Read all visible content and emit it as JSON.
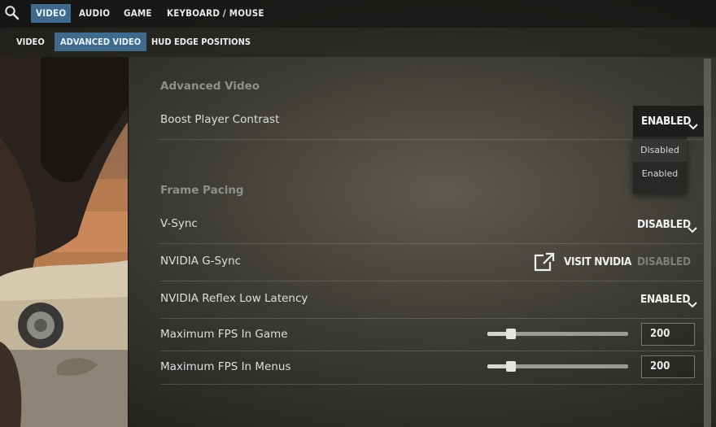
{
  "top_nav": {
    "search_icon": "search-icon",
    "tabs": [
      {
        "label": "VIDEO",
        "active": true
      },
      {
        "label": "AUDIO",
        "active": false
      },
      {
        "label": "GAME",
        "active": false
      },
      {
        "label": "KEYBOARD / MOUSE",
        "active": false
      }
    ]
  },
  "sub_nav": {
    "tabs": [
      {
        "label": "VIDEO",
        "active": false
      },
      {
        "label": "ADVANCED VIDEO",
        "active": true
      },
      {
        "label": "HUD EDGE POSITIONS",
        "active": false
      }
    ]
  },
  "advanced_video": {
    "title": "Advanced Video",
    "boost_player_contrast": {
      "label": "Boost Player Contrast",
      "value": "ENABLED",
      "options": [
        "Disabled",
        "Enabled"
      ],
      "open": true
    }
  },
  "frame_pacing": {
    "title": "Frame Pacing",
    "vsync": {
      "label": "V-Sync",
      "value": "DISABLED"
    },
    "gsync": {
      "label": "NVIDIA G-Sync",
      "link_label": "VISIT NVIDIA",
      "link_icon": "external-link-icon",
      "value": "DISABLED"
    },
    "reflex": {
      "label": "NVIDIA Reflex Low Latency",
      "value": "ENABLED"
    },
    "max_fps_game": {
      "label": "Maximum FPS In Game",
      "value": "200",
      "slider_fraction": 0.17
    },
    "max_fps_menus": {
      "label": "Maximum FPS In Menus",
      "value": "200",
      "slider_fraction": 0.17
    }
  },
  "colors": {
    "accent_tab": "#3f6a8c",
    "panel_bg": "#3f3d37"
  }
}
